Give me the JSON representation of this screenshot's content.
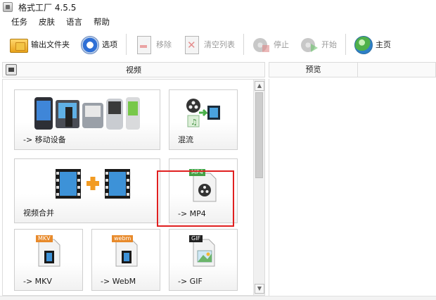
{
  "window": {
    "title": "格式工厂 4.5.5"
  },
  "menu": [
    "任务",
    "皮肤",
    "语言",
    "帮助"
  ],
  "toolbar": {
    "output_folder": "输出文件夹",
    "options": "选项",
    "remove": "移除",
    "clear_list": "清空列表",
    "stop": "停止",
    "start": "开始",
    "home": "主页"
  },
  "left_panel": {
    "title": "视频"
  },
  "tiles": {
    "mobile": "-> 移动设备",
    "mux": "混流",
    "join": "视频合并",
    "mp4": "-> MP4",
    "mp4_badge": "MP4",
    "mkv": "-> MKV",
    "mkv_badge": "MKV",
    "webm": "-> WebM",
    "webm_badge": "webm",
    "gif": "-> GIF",
    "gif_badge": "GIF"
  },
  "right_panel": {
    "column": "预览"
  },
  "colors": {
    "highlight": "#e02020",
    "accent": "#2e6fd6"
  }
}
